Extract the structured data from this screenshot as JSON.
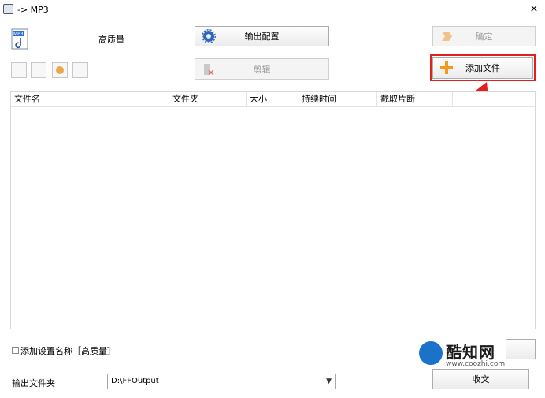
{
  "window": {
    "title": "-> MP3",
    "close_symbol": "×"
  },
  "profile": {
    "quality_label": "高质量"
  },
  "buttons": {
    "output_config": "输出配置",
    "confirm": "确定",
    "trim": "剪辑",
    "add_file": "添加文件",
    "bottom_right": "收文"
  },
  "table": {
    "headers": [
      "文件名",
      "文件夹",
      "大小",
      "持续时间",
      "截取片断"
    ],
    "rows": []
  },
  "options": {
    "add_setting_name_label": "添加设置名称［高质量］",
    "output_folder_label": "输出文件夹",
    "output_folder_value": "D:\\FFOutput"
  },
  "watermark": {
    "brand": "酷知网",
    "url": "www.coozhi.com"
  },
  "colors": {
    "annotation_red": "#e21f1f",
    "add_icon_orange": "#f39a1e"
  },
  "icons": [
    "app-icon",
    "mp3-file-icon",
    "gear-icon",
    "arrow-right-icon",
    "trim-icon",
    "plus-icon"
  ]
}
